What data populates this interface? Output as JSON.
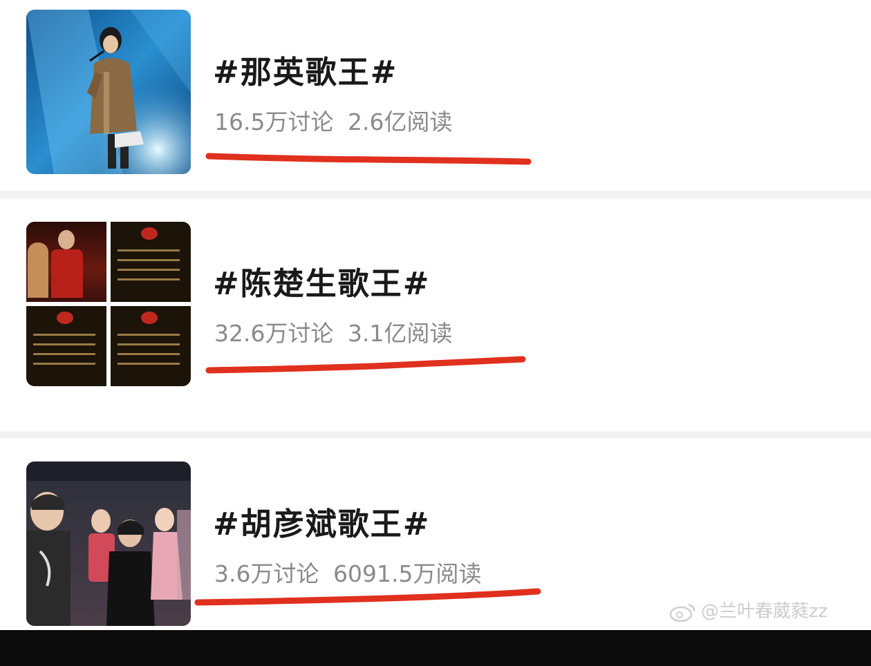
{
  "topics": [
    {
      "title": "#那英歌王#",
      "discussions": "16.5万讨论",
      "reads": "2.6亿阅读"
    },
    {
      "title": "#陈楚生歌王#",
      "discussions": "32.6万讨论",
      "reads": "3.1亿阅读"
    },
    {
      "title": "#胡彦斌歌王#",
      "discussions": "3.6万讨论",
      "reads": "6091.5万阅读"
    }
  ],
  "watermark": {
    "text": "@兰叶春葳蕤zz",
    "icon": "weibo-icon"
  },
  "colors": {
    "underline": "#e0301e",
    "stats": "#8a8a8a",
    "title": "#1a1a1a"
  }
}
